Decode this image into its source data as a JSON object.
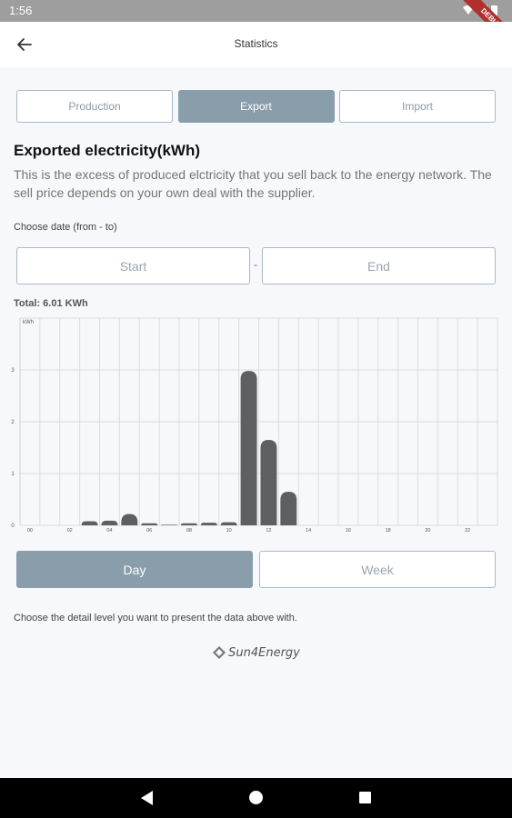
{
  "status_bar": {
    "time": "1:56",
    "debug_banner": "DEBUG"
  },
  "app_bar": {
    "title": "Statistics"
  },
  "tabs": [
    {
      "label": "Production",
      "active": false
    },
    {
      "label": "Export",
      "active": true
    },
    {
      "label": "Import",
      "active": false
    }
  ],
  "heading": "Exported electricity(kWh)",
  "description": "This is the excess of produced elctricity that you sell back to the energy network. The sell price depends on your own deal with the supplier.",
  "date_range": {
    "label": "Choose date (from - to)",
    "start_placeholder": "Start",
    "separator": "-",
    "end_placeholder": "End"
  },
  "total": "Total: 6.01 KWh",
  "chart_data": {
    "type": "bar",
    "ylabel": "kWh",
    "ylim": [
      0,
      4
    ],
    "yticks": [
      "0",
      "1",
      "2",
      "3"
    ],
    "x_tick_labels": [
      "00",
      "02",
      "04",
      "06",
      "08",
      "10",
      "12",
      "14",
      "16",
      "18",
      "20",
      "22"
    ],
    "categories": [
      "00",
      "01",
      "02",
      "03",
      "04",
      "05",
      "06",
      "07",
      "08",
      "09",
      "10",
      "11",
      "12",
      "13",
      "14",
      "15",
      "16",
      "17",
      "18",
      "19",
      "20",
      "21",
      "22",
      "23"
    ],
    "values": [
      0,
      0,
      0,
      0.08,
      0.09,
      0.22,
      0.04,
      0.01,
      0.04,
      0.05,
      0.06,
      2.98,
      1.65,
      0.65,
      0,
      0,
      0,
      0,
      0,
      0,
      0,
      0,
      0,
      0
    ],
    "bar_color": "#5d5f63",
    "grid": true
  },
  "range_buttons": [
    {
      "label": "Day",
      "active": true
    },
    {
      "label": "Week",
      "active": false
    }
  ],
  "detail_text": "Choose the detail level you want to present the data above with.",
  "logo": {
    "text": "Sun4Energy"
  },
  "colors": {
    "accent": "#8a9dab",
    "border": "#a9b8c4",
    "background": "#f7f8fb"
  }
}
